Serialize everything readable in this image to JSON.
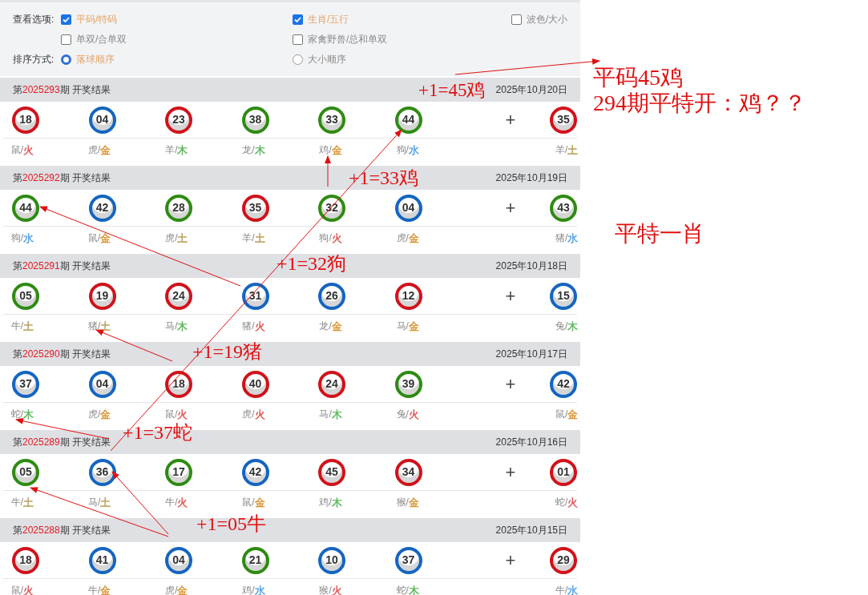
{
  "options": {
    "rows": [
      {
        "label": "查看选项:",
        "items": [
          {
            "kind": "checkbox",
            "text": "平码/特码",
            "checked": true
          },
          {
            "kind": "checkbox",
            "text": "生肖/五行",
            "checked": true
          },
          {
            "kind": "checkbox",
            "text": "波色/大小",
            "checked": false
          }
        ]
      },
      {
        "items": [
          {
            "kind": "checkbox",
            "text": "单双/合单双",
            "checked": false
          },
          {
            "kind": "checkbox",
            "text": "家禽野兽/总和单双",
            "checked": false
          }
        ]
      },
      {
        "label": "排序方式:",
        "items": [
          {
            "kind": "radio",
            "text": "落球顺序",
            "selected": true
          },
          {
            "kind": "radio",
            "text": "大小顺序",
            "selected": false
          }
        ]
      }
    ]
  },
  "draws": [
    {
      "prefix": "第",
      "period": "2025293",
      "suffix": "期 开奖结果",
      "date": "2025年10月20日",
      "separator": "+",
      "balls": [
        {
          "number": "18",
          "color": "#d0121b",
          "label": "鼠/",
          "element": {
            "text": "火",
            "color": "#e05252"
          }
        },
        {
          "number": "04",
          "color": "#1565c0",
          "label": "虎/",
          "element": {
            "text": "金",
            "color": "#d9912a"
          }
        },
        {
          "number": "23",
          "color": "#d0121b",
          "label": "羊/",
          "element": {
            "text": "木",
            "color": "#5cb85c"
          }
        },
        {
          "number": "38",
          "color": "#2e8b12",
          "label": "龙/",
          "element": {
            "text": "木",
            "color": "#5cb85c"
          }
        },
        {
          "number": "33",
          "color": "#2e8b12",
          "label": "鸡/",
          "element": {
            "text": "金",
            "color": "#d9912a"
          }
        },
        {
          "number": "44",
          "color": "#2e8b12",
          "label": "狗/",
          "element": {
            "text": "水",
            "color": "#4a9ee0"
          }
        },
        {
          "number": "35",
          "color": "#d0121b",
          "label": "羊/",
          "element": {
            "text": "土",
            "color": "#b89a50"
          }
        }
      ]
    },
    {
      "prefix": "第",
      "period": "2025292",
      "suffix": "期 开奖结果",
      "date": "2025年10月19日",
      "separator": "+",
      "balls": [
        {
          "number": "44",
          "color": "#2e8b12",
          "label": "狗/",
          "element": {
            "text": "水",
            "color": "#4a9ee0"
          }
        },
        {
          "number": "42",
          "color": "#1565c0",
          "label": "鼠/",
          "element": {
            "text": "金",
            "color": "#d9912a"
          }
        },
        {
          "number": "28",
          "color": "#2e8b12",
          "label": "虎/",
          "element": {
            "text": "土",
            "color": "#b89a50"
          }
        },
        {
          "number": "35",
          "color": "#d0121b",
          "label": "羊/",
          "element": {
            "text": "土",
            "color": "#b89a50"
          }
        },
        {
          "number": "32",
          "color": "#2e8b12",
          "label": "狗/",
          "element": {
            "text": "火",
            "color": "#e05252"
          }
        },
        {
          "number": "04",
          "color": "#1565c0",
          "label": "虎/",
          "element": {
            "text": "金",
            "color": "#d9912a"
          }
        },
        {
          "number": "43",
          "color": "#2e8b12",
          "label": "猪/",
          "element": {
            "text": "水",
            "color": "#4a9ee0"
          }
        }
      ]
    },
    {
      "prefix": "第",
      "period": "2025291",
      "suffix": "期 开奖结果",
      "date": "2025年10月18日",
      "separator": "+",
      "balls": [
        {
          "number": "05",
          "color": "#2e8b12",
          "label": "牛/",
          "element": {
            "text": "土",
            "color": "#b89a50"
          }
        },
        {
          "number": "19",
          "color": "#d0121b",
          "label": "猪/",
          "element": {
            "text": "土",
            "color": "#b89a50"
          }
        },
        {
          "number": "24",
          "color": "#d0121b",
          "label": "马/",
          "element": {
            "text": "木",
            "color": "#5cb85c"
          }
        },
        {
          "number": "31",
          "color": "#1565c0",
          "label": "猪/",
          "element": {
            "text": "火",
            "color": "#e05252"
          }
        },
        {
          "number": "26",
          "color": "#1565c0",
          "label": "龙/",
          "element": {
            "text": "金",
            "color": "#d9912a"
          }
        },
        {
          "number": "12",
          "color": "#d0121b",
          "label": "马/",
          "element": {
            "text": "金",
            "color": "#d9912a"
          }
        },
        {
          "number": "15",
          "color": "#1565c0",
          "label": "兔/",
          "element": {
            "text": "木",
            "color": "#5cb85c"
          }
        }
      ]
    },
    {
      "prefix": "第",
      "period": "2025290",
      "suffix": "期 开奖结果",
      "date": "2025年10月17日",
      "separator": "+",
      "balls": [
        {
          "number": "37",
          "color": "#1565c0",
          "label": "蛇/",
          "element": {
            "text": "木",
            "color": "#5cb85c"
          }
        },
        {
          "number": "04",
          "color": "#1565c0",
          "label": "虎/",
          "element": {
            "text": "金",
            "color": "#d9912a"
          }
        },
        {
          "number": "18",
          "color": "#d0121b",
          "label": "鼠/",
          "element": {
            "text": "火",
            "color": "#e05252"
          }
        },
        {
          "number": "40",
          "color": "#d0121b",
          "label": "虎/",
          "element": {
            "text": "火",
            "color": "#e05252"
          }
        },
        {
          "number": "24",
          "color": "#d0121b",
          "label": "马/",
          "element": {
            "text": "木",
            "color": "#5cb85c"
          }
        },
        {
          "number": "39",
          "color": "#2e8b12",
          "label": "兔/",
          "element": {
            "text": "火",
            "color": "#e05252"
          }
        },
        {
          "number": "42",
          "color": "#1565c0",
          "label": "鼠/",
          "element": {
            "text": "金",
            "color": "#d9912a"
          }
        }
      ]
    },
    {
      "prefix": "第",
      "period": "2025289",
      "suffix": "期 开奖结果",
      "date": "2025年10月16日",
      "separator": "+",
      "balls": [
        {
          "number": "05",
          "color": "#2e8b12",
          "label": "牛/",
          "element": {
            "text": "土",
            "color": "#b89a50"
          }
        },
        {
          "number": "36",
          "color": "#1565c0",
          "label": "马/",
          "element": {
            "text": "土",
            "color": "#b89a50"
          }
        },
        {
          "number": "17",
          "color": "#2e8b12",
          "label": "牛/",
          "element": {
            "text": "火",
            "color": "#e05252"
          }
        },
        {
          "number": "42",
          "color": "#1565c0",
          "label": "鼠/",
          "element": {
            "text": "金",
            "color": "#d9912a"
          }
        },
        {
          "number": "45",
          "color": "#d0121b",
          "label": "鸡/",
          "element": {
            "text": "木",
            "color": "#5cb85c"
          }
        },
        {
          "number": "34",
          "color": "#d0121b",
          "label": "猴/",
          "element": {
            "text": "金",
            "color": "#d9912a"
          }
        },
        {
          "number": "01",
          "color": "#d0121b",
          "label": "蛇/",
          "element": {
            "text": "火",
            "color": "#e05252"
          }
        }
      ]
    },
    {
      "prefix": "第",
      "period": "2025288",
      "suffix": "期 开奖结果",
      "date": "2025年10月15日",
      "separator": "+",
      "balls": [
        {
          "number": "18",
          "color": "#d0121b",
          "label": "鼠/",
          "element": {
            "text": "火",
            "color": "#e05252"
          }
        },
        {
          "number": "41",
          "color": "#1565c0",
          "label": "牛/",
          "element": {
            "text": "金",
            "color": "#d9912a"
          }
        },
        {
          "number": "04",
          "color": "#1565c0",
          "label": "虎/",
          "element": {
            "text": "金",
            "color": "#d9912a"
          }
        },
        {
          "number": "21",
          "color": "#2e8b12",
          "label": "鸡/",
          "element": {
            "text": "水",
            "color": "#4a9ee0"
          }
        },
        {
          "number": "10",
          "color": "#1565c0",
          "label": "猴/",
          "element": {
            "text": "火",
            "color": "#e05252"
          }
        },
        {
          "number": "37",
          "color": "#1565c0",
          "label": "蛇/",
          "element": {
            "text": "木",
            "color": "#5cb85c"
          }
        },
        {
          "number": "29",
          "color": "#d0121b",
          "label": "牛/",
          "element": {
            "text": "水",
            "color": "#4a9ee0"
          }
        }
      ]
    }
  ],
  "annotations": [
    "+1=45鸡",
    "+1=33鸡",
    "+1=32狗",
    "+1=19猪",
    "+1=37蛇",
    "+1=05牛",
    "平码45鸡",
    "294期平特开：鸡？？",
    "平特一肖"
  ]
}
